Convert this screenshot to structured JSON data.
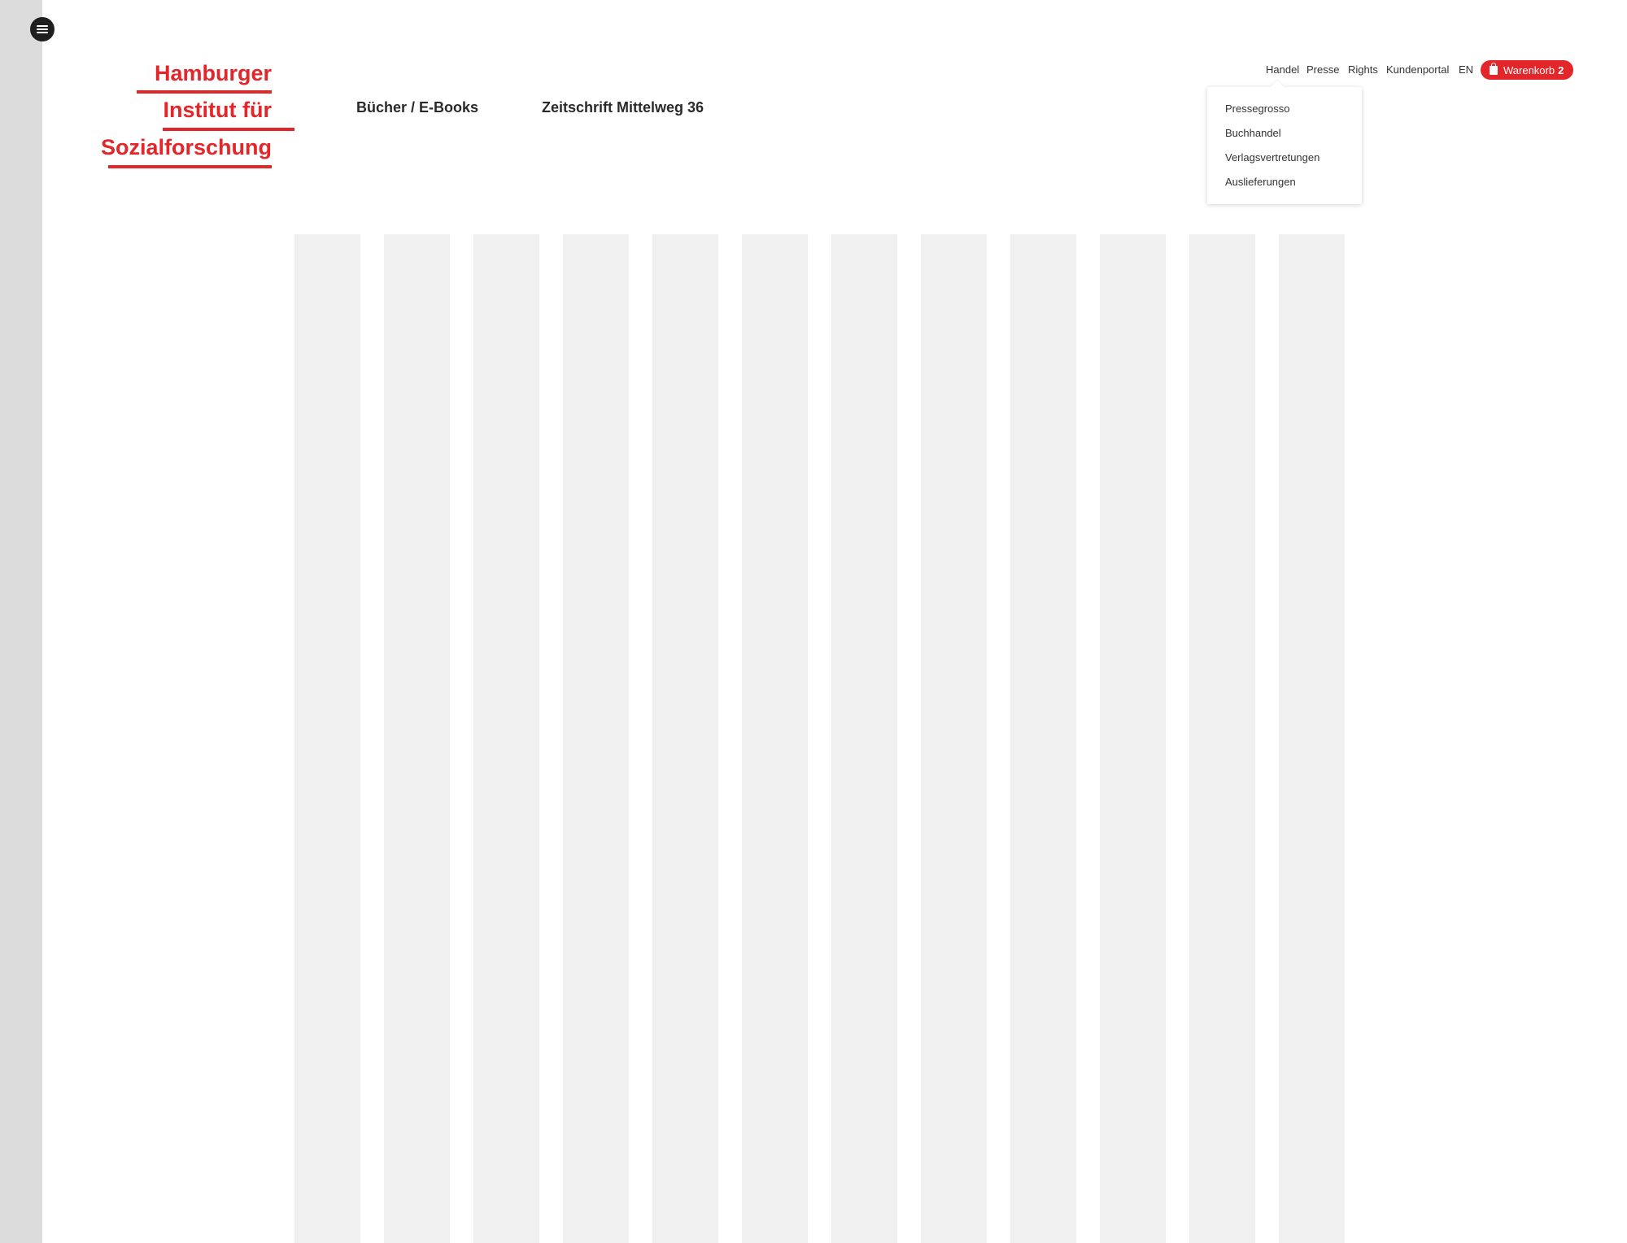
{
  "logo": {
    "line1": "Hamburger",
    "line2": "Institut für",
    "line3": "Sozialforschung"
  },
  "main_nav": {
    "books": "Bücher / E-Books",
    "journal": "Zeitschrift Mittelweg 36"
  },
  "utility_nav": {
    "handel": "Handel",
    "presse": "Presse",
    "rights": "Rights",
    "kundenportal": "Kundenportal",
    "language": "EN",
    "cart_label": "Warenkorb",
    "cart_count": "2"
  },
  "handel_dropdown": {
    "items": [
      "Pressegrosso",
      "Buchhandel",
      "Verlagsvertretungen",
      "Auslieferungen"
    ]
  },
  "icons": {
    "menu": "hamburger-menu-icon",
    "cart": "shopping-bag-icon"
  },
  "colors": {
    "brand_red": "#e3262a",
    "placeholder_gray": "#f0f0f0",
    "rail_gray": "#dcdcdc"
  }
}
